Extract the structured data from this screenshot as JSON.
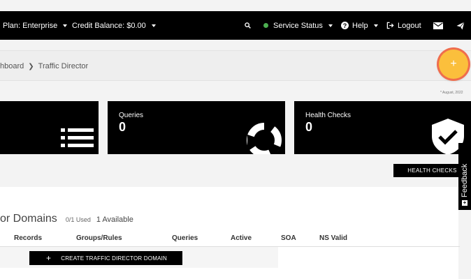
{
  "topbar": {
    "plan": "Plan: Enterprise",
    "credit": "Credit Balance: $0.00",
    "service_status": "Service Status",
    "help": "Help",
    "logout": "Logout"
  },
  "breadcrumb": {
    "parent": "hboard",
    "current": "Traffic Director"
  },
  "fab": {
    "label": "+"
  },
  "date_note": "* August, 2022",
  "cards": [
    {
      "label": "",
      "value": "",
      "icon": "list-icon"
    },
    {
      "label": "Queries",
      "value": "0",
      "icon": "donut-icon"
    },
    {
      "label": "Health Checks",
      "value": "0",
      "icon": "shield-check-icon"
    }
  ],
  "health_checks_button": "HEALTH CHECKS",
  "feedback": "Feedback",
  "domains": {
    "title": "or Domains",
    "used": "0/1 Used",
    "available": "1 Available",
    "columns": [
      "Records",
      "Groups/Rules",
      "Queries",
      "Active",
      "SOA",
      "NS Valid"
    ],
    "create_button": "CREATE TRAFFIC DIRECTOR DOMAIN",
    "create_plus": "+"
  },
  "colors": {
    "topbar": "#000000",
    "status_ok": "#4caf50",
    "fab": "#fbbf3c",
    "fab_ring": "#ef6d4d"
  }
}
